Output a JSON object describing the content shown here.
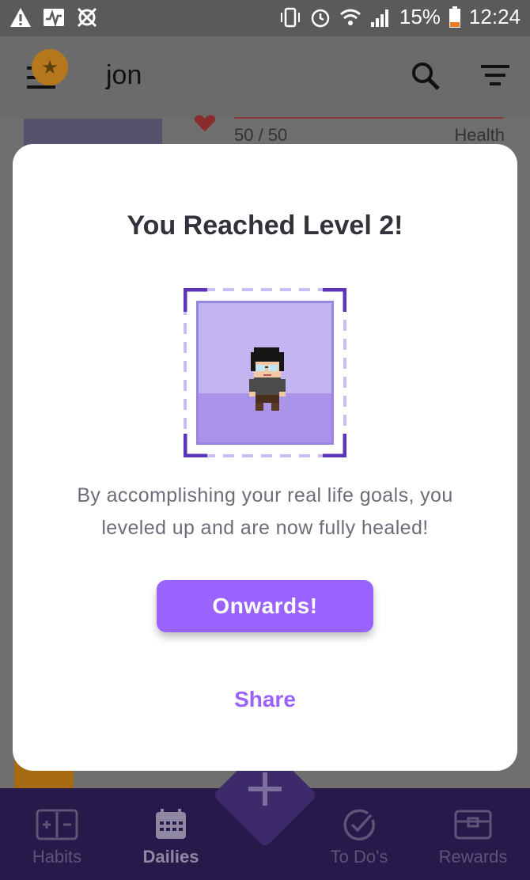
{
  "status_bar": {
    "battery": "15%",
    "time": "12:24"
  },
  "app_bar": {
    "title": "jon"
  },
  "stats": {
    "health_value": "50 / 50",
    "health_label": "Health"
  },
  "dialog": {
    "title": "You Reached Level 2!",
    "description": "By accomplishing your real life goals, you leveled up and are now fully healed!",
    "primary_button": "Onwards!",
    "secondary_button": "Share"
  },
  "bottom_nav": {
    "items": [
      {
        "label": "Habits",
        "icon": "habits-icon"
      },
      {
        "label": "Dailies",
        "icon": "calendar-icon",
        "active": true
      },
      {
        "label": "To Do's",
        "icon": "check-circle-icon"
      },
      {
        "label": "Rewards",
        "icon": "treasure-chest-icon"
      }
    ]
  },
  "colors": {
    "accent": "#9a62ff",
    "nav_bg": "#271a4a",
    "dialog_bg": "#ffffff"
  }
}
